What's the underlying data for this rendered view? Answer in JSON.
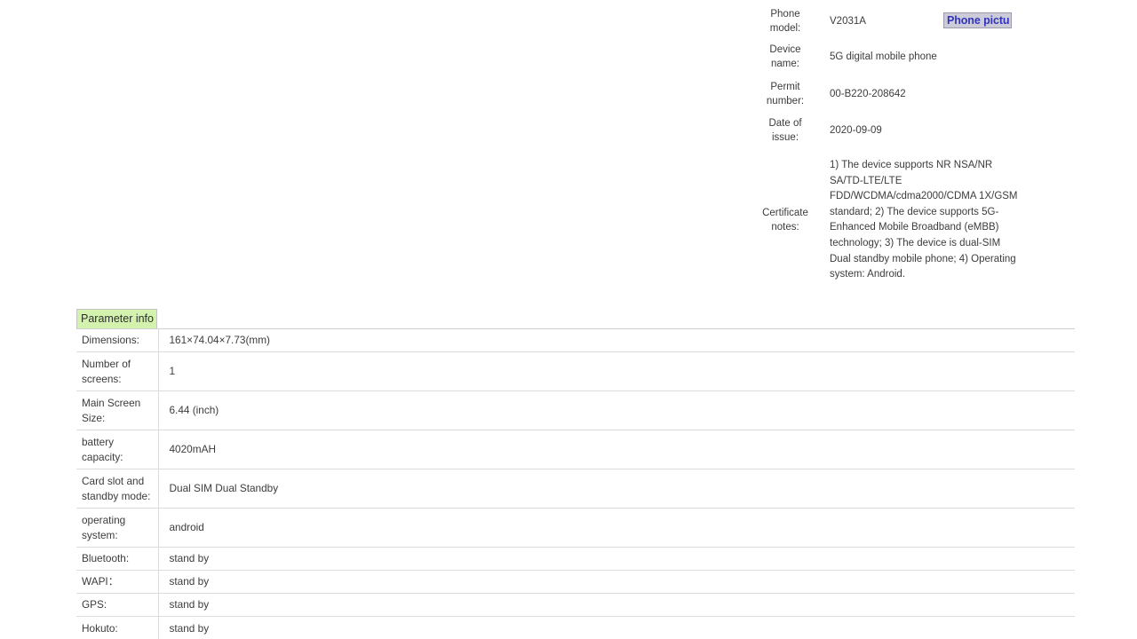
{
  "certificate": {
    "fields": [
      {
        "label": "Phone model:",
        "value": "V2031A"
      },
      {
        "label": "Device name:",
        "value": "5G digital mobile phone"
      },
      {
        "label": "Permit number:",
        "value": "00-B220-208642"
      },
      {
        "label": "Date of issue:",
        "value": "2020-09-09"
      },
      {
        "label": "Certificate notes:",
        "value": "1) The device supports NR NSA/NR SA/TD-LTE/LTE FDD/WCDMA/cdma2000/CDMA 1X/GSM standard; 2) The device supports 5G-Enhanced Mobile Broadband (eMBB) technology; 3) The device is dual-SIM Dual standby mobile phone; 4) Operating system: Android."
      }
    ],
    "phone_picture_link": "Phone pictu"
  },
  "parameter_table": {
    "header": "Parameter info",
    "rows": [
      {
        "key": "Dimensions:",
        "value": "161×74.04×7.73(mm)",
        "tall": false
      },
      {
        "key": "Number of screens:",
        "value": "1",
        "tall": true
      },
      {
        "key": "Main Screen Size:",
        "value": "6.44 (inch)",
        "tall": true
      },
      {
        "key": "battery capacity:",
        "value": "4020mAH",
        "tall": true
      },
      {
        "key": "Card slot and standby mode:",
        "value": "Dual SIM Dual Standby",
        "tall": true
      },
      {
        "key": "operating system:",
        "value": "android",
        "tall": true
      },
      {
        "key": "Bluetooth:",
        "value": "stand by",
        "tall": false
      },
      {
        "key": "WAPI：",
        "value": "stand by",
        "tall": false
      },
      {
        "key": "GPS:",
        "value": "stand by",
        "tall": false
      },
      {
        "key": "Hokuto:",
        "value": "stand by",
        "tall": false
      }
    ]
  },
  "colors": {
    "header_highlight": "#d2f2ae",
    "link_text": "#3333bb",
    "selection_background": "#ccccd8",
    "row_divider": "#dcdcdc",
    "body_text": "#3c3c3c"
  }
}
